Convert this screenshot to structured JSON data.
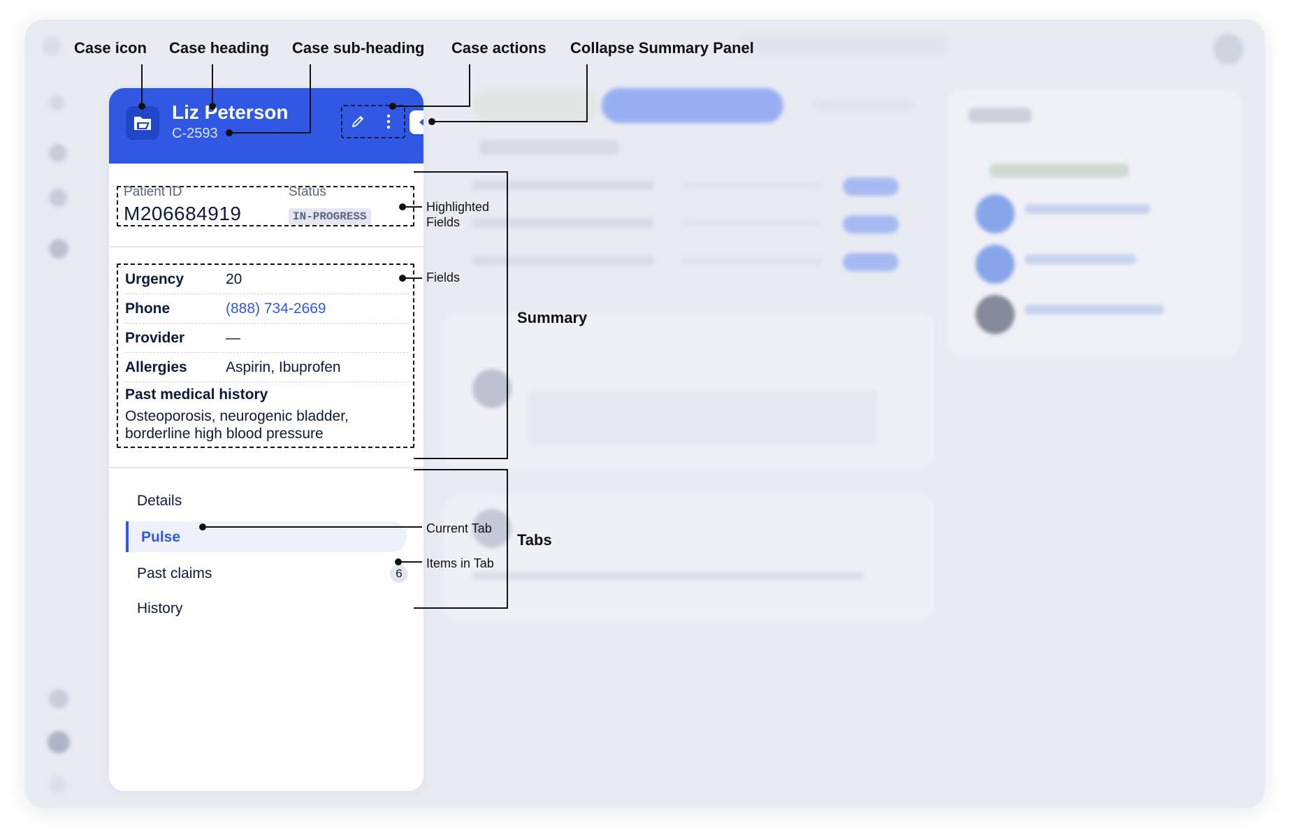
{
  "case": {
    "heading": "Liz Peterson",
    "sub_heading": "C-2593",
    "icon": "folder-icon",
    "actions": [
      "pencil-icon",
      "more-vertical-icon"
    ],
    "collapse_icon": "caret-left-icon"
  },
  "highlighted": {
    "patient_id_label": "Patient ID",
    "patient_id_value": "M206684919",
    "status_label": "Status",
    "status_value": "IN-PROGRESS"
  },
  "fields": [
    {
      "label": "Urgency",
      "value": "20"
    },
    {
      "label": "Phone",
      "value": "(888) 734-2669"
    },
    {
      "label": "Provider",
      "value": "—"
    },
    {
      "label": "Allergies",
      "value": "Aspirin, Ibuprofen"
    }
  ],
  "history": {
    "label": "Past medical history",
    "value": "Osteoporosis, neurogenic bladder, borderline high blood pressure"
  },
  "tabs": [
    {
      "label": "Details"
    },
    {
      "label": "Pulse",
      "active": true
    },
    {
      "label": "Past claims",
      "count": "6"
    },
    {
      "label": "History"
    }
  ],
  "annotations": {
    "case_icon": "Case icon",
    "case_heading": "Case heading",
    "case_sub_heading": "Case sub-heading",
    "case_actions": "Case actions",
    "collapse": "Collapse Summary Panel",
    "highlighted_fields": "Highlighted Fields",
    "fields": "Fields",
    "summary": "Summary",
    "current_tab": "Current Tab",
    "items_in_tab": "Items in Tab",
    "tabs": "Tabs"
  },
  "colors": {
    "accent": "#3158e3",
    "background": "#e9ebf3"
  }
}
